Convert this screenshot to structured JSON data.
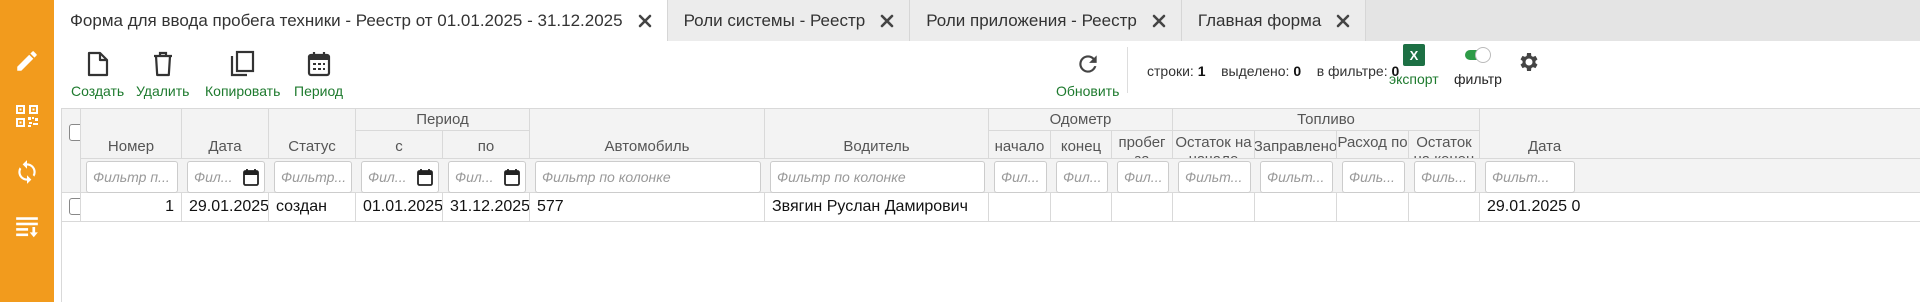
{
  "sidebar": {
    "items": [
      {
        "icon": "pencil-icon"
      },
      {
        "icon": "qr-code-icon"
      },
      {
        "icon": "sync-icon"
      },
      {
        "icon": "list-download-icon"
      }
    ]
  },
  "tabs": [
    {
      "label": "Форма для ввода пробега техники - Реестр от 01.01.2025 - 31.12.2025",
      "active": true
    },
    {
      "label": "Роли системы - Реестр",
      "active": false
    },
    {
      "label": "Роли приложения - Реестр",
      "active": false
    },
    {
      "label": "Главная форма",
      "active": false
    }
  ],
  "toolbar": {
    "create": "Создать",
    "delete": "Удалить",
    "copy": "Копировать",
    "period": "Период",
    "refresh": "Обновить",
    "export": "экспорт",
    "filter": "фильтр"
  },
  "stats": {
    "rows_label": "строки:",
    "rows_value": "1",
    "selected_label": "выделено:",
    "selected_value": "0",
    "filtered_label": "в фильтре:",
    "filtered_value": "0"
  },
  "table": {
    "groups": {
      "period": "Период",
      "odometer": "Одометр",
      "fuel": "Топливо"
    },
    "columns": {
      "number": "Номер",
      "date": "Дата",
      "status": "Статус",
      "from": "с",
      "to": "по",
      "car": "Автомобиль",
      "driver": "Водитель",
      "odo_start": "начало",
      "odo_end": "конец",
      "mileage": "пробег за",
      "fuel_start": "Остаток на начало",
      "fuel_filled": "Заправлено",
      "fuel_usage": "Расход по",
      "fuel_end": "Остаток на конец",
      "date2": "Дата"
    },
    "filters": {
      "number": "Фильтр п...",
      "date": "Фил...",
      "status": "Фильтр...",
      "from": "Фил...",
      "to": "Фил...",
      "car": "Фильтр по колонке",
      "driver": "Фильтр по колонке",
      "odo_start": "Фил...",
      "odo_end": "Фил...",
      "mileage": "Фил...",
      "fuel_start": "Фильт...",
      "fuel_filled": "Фильт...",
      "fuel_usage": "Филь...",
      "fuel_end": "Филь...",
      "date2": "Фильт..."
    },
    "rows": [
      {
        "number": "1",
        "date": "29.01.2025",
        "status": "создан",
        "from": "01.01.2025",
        "to": "31.12.2025",
        "car": "577",
        "driver": "Звягин Руслан Дамирович",
        "date2": "29.01.2025 0"
      }
    ]
  },
  "colors": {
    "sidebar": "#f29b1d",
    "accent_green": "#1e7a2e",
    "excel_green": "#1d7044"
  }
}
